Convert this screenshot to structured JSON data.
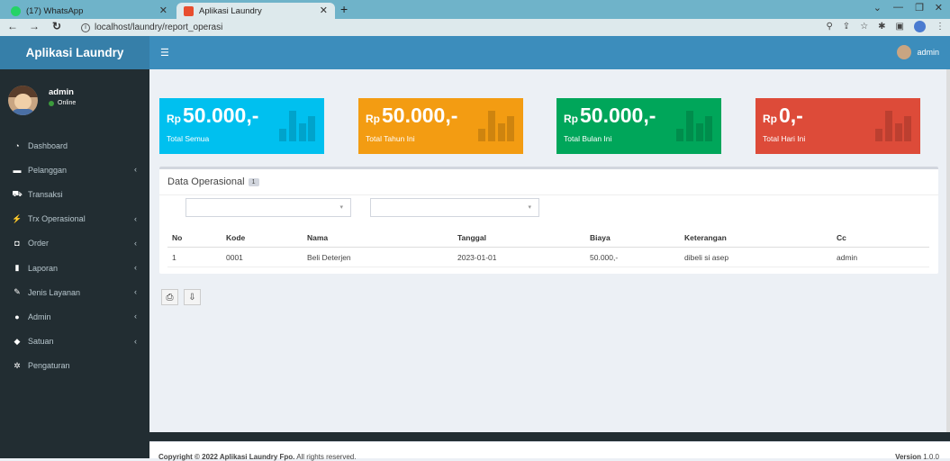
{
  "browser": {
    "tabs": [
      {
        "label": "(17) WhatsApp",
        "active": false,
        "icon": "whatsapp-icon",
        "color": "#25d366"
      },
      {
        "label": "Aplikasi Laundry",
        "active": true,
        "icon": "app-favicon",
        "color": "#e84e2f"
      }
    ],
    "url": "localhost/laundry/report_operasi"
  },
  "app": {
    "logo": "Aplikasi Laundry",
    "user": {
      "name": "admin",
      "status": "Online"
    },
    "top_user": "admin"
  },
  "sidebar": {
    "items": [
      {
        "label": "Dashboard",
        "icon": "dashboard-icon",
        "has_submenu": false
      },
      {
        "label": "Pelanggan",
        "icon": "customer-icon",
        "has_submenu": true
      },
      {
        "label": "Transaksi",
        "icon": "cart-icon",
        "has_submenu": false
      },
      {
        "label": "Trx Operasional",
        "icon": "bolt-icon",
        "has_submenu": true
      },
      {
        "label": "Order",
        "icon": "order-icon",
        "has_submenu": true
      },
      {
        "label": "Laporan",
        "icon": "chart-icon",
        "has_submenu": true
      },
      {
        "label": "Jenis Layanan",
        "icon": "pin-icon",
        "has_submenu": true
      },
      {
        "label": "Admin",
        "icon": "user-icon",
        "has_submenu": true
      },
      {
        "label": "Satuan",
        "icon": "tag-icon",
        "has_submenu": true
      },
      {
        "label": "Pengaturan",
        "icon": "gear-icon",
        "has_submenu": false
      }
    ]
  },
  "stat_boxes": [
    {
      "currency": "Rp",
      "value": "50.000,-",
      "label": "Total Semua",
      "color": "#00c0ef"
    },
    {
      "currency": "Rp",
      "value": "50.000,-",
      "label": "Total Tahun Ini",
      "color": "#f39c12"
    },
    {
      "currency": "Rp",
      "value": "50.000,-",
      "label": "Total Bulan Ini",
      "color": "#00a65a"
    },
    {
      "currency": "Rp",
      "value": "0,-",
      "label": "Total Hari Ini",
      "color": "#dd4b39"
    }
  ],
  "panel": {
    "title": "Data Operasional",
    "badge": "1",
    "columns": [
      "No",
      "Kode",
      "Nama",
      "Tanggal",
      "Biaya",
      "Keterangan",
      "Cc"
    ],
    "rows": [
      [
        "1",
        "0001",
        "Beli Deterjen",
        "2023-01-01",
        "50.000,-",
        "dibeli si asep",
        "admin"
      ]
    ]
  },
  "footer": {
    "copyright": "Copyright © 2022 Aplikasi Laundry Fpo.",
    "rights": " All rights reserved.",
    "version_label": "Version",
    "version": "1.0.0"
  }
}
